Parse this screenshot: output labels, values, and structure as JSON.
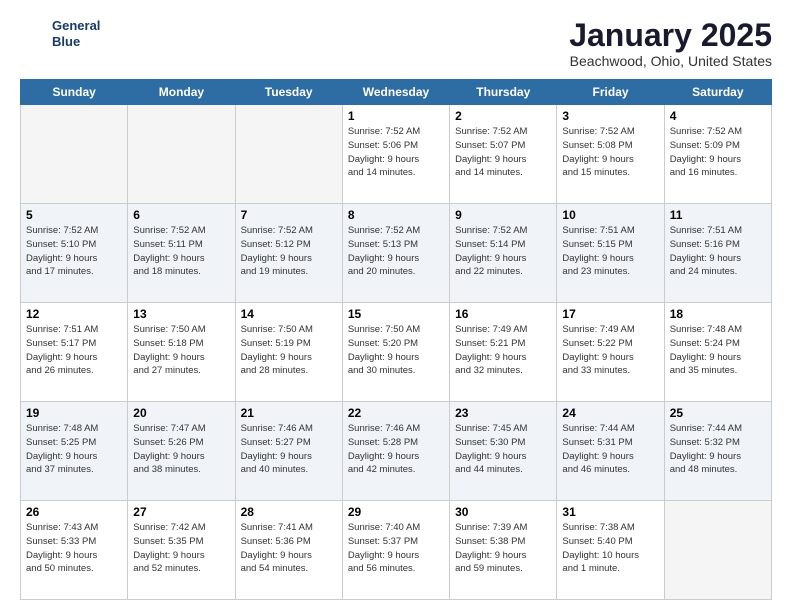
{
  "header": {
    "logo_line1": "General",
    "logo_line2": "Blue",
    "month_title": "January 2025",
    "location": "Beachwood, Ohio, United States"
  },
  "days_of_week": [
    "Sunday",
    "Monday",
    "Tuesday",
    "Wednesday",
    "Thursday",
    "Friday",
    "Saturday"
  ],
  "weeks": [
    {
      "shade": false,
      "days": [
        {
          "num": "",
          "info": ""
        },
        {
          "num": "",
          "info": ""
        },
        {
          "num": "",
          "info": ""
        },
        {
          "num": "1",
          "info": "Sunrise: 7:52 AM\nSunset: 5:06 PM\nDaylight: 9 hours\nand 14 minutes."
        },
        {
          "num": "2",
          "info": "Sunrise: 7:52 AM\nSunset: 5:07 PM\nDaylight: 9 hours\nand 14 minutes."
        },
        {
          "num": "3",
          "info": "Sunrise: 7:52 AM\nSunset: 5:08 PM\nDaylight: 9 hours\nand 15 minutes."
        },
        {
          "num": "4",
          "info": "Sunrise: 7:52 AM\nSunset: 5:09 PM\nDaylight: 9 hours\nand 16 minutes."
        }
      ]
    },
    {
      "shade": true,
      "days": [
        {
          "num": "5",
          "info": "Sunrise: 7:52 AM\nSunset: 5:10 PM\nDaylight: 9 hours\nand 17 minutes."
        },
        {
          "num": "6",
          "info": "Sunrise: 7:52 AM\nSunset: 5:11 PM\nDaylight: 9 hours\nand 18 minutes."
        },
        {
          "num": "7",
          "info": "Sunrise: 7:52 AM\nSunset: 5:12 PM\nDaylight: 9 hours\nand 19 minutes."
        },
        {
          "num": "8",
          "info": "Sunrise: 7:52 AM\nSunset: 5:13 PM\nDaylight: 9 hours\nand 20 minutes."
        },
        {
          "num": "9",
          "info": "Sunrise: 7:52 AM\nSunset: 5:14 PM\nDaylight: 9 hours\nand 22 minutes."
        },
        {
          "num": "10",
          "info": "Sunrise: 7:51 AM\nSunset: 5:15 PM\nDaylight: 9 hours\nand 23 minutes."
        },
        {
          "num": "11",
          "info": "Sunrise: 7:51 AM\nSunset: 5:16 PM\nDaylight: 9 hours\nand 24 minutes."
        }
      ]
    },
    {
      "shade": false,
      "days": [
        {
          "num": "12",
          "info": "Sunrise: 7:51 AM\nSunset: 5:17 PM\nDaylight: 9 hours\nand 26 minutes."
        },
        {
          "num": "13",
          "info": "Sunrise: 7:50 AM\nSunset: 5:18 PM\nDaylight: 9 hours\nand 27 minutes."
        },
        {
          "num": "14",
          "info": "Sunrise: 7:50 AM\nSunset: 5:19 PM\nDaylight: 9 hours\nand 28 minutes."
        },
        {
          "num": "15",
          "info": "Sunrise: 7:50 AM\nSunset: 5:20 PM\nDaylight: 9 hours\nand 30 minutes."
        },
        {
          "num": "16",
          "info": "Sunrise: 7:49 AM\nSunset: 5:21 PM\nDaylight: 9 hours\nand 32 minutes."
        },
        {
          "num": "17",
          "info": "Sunrise: 7:49 AM\nSunset: 5:22 PM\nDaylight: 9 hours\nand 33 minutes."
        },
        {
          "num": "18",
          "info": "Sunrise: 7:48 AM\nSunset: 5:24 PM\nDaylight: 9 hours\nand 35 minutes."
        }
      ]
    },
    {
      "shade": true,
      "days": [
        {
          "num": "19",
          "info": "Sunrise: 7:48 AM\nSunset: 5:25 PM\nDaylight: 9 hours\nand 37 minutes."
        },
        {
          "num": "20",
          "info": "Sunrise: 7:47 AM\nSunset: 5:26 PM\nDaylight: 9 hours\nand 38 minutes."
        },
        {
          "num": "21",
          "info": "Sunrise: 7:46 AM\nSunset: 5:27 PM\nDaylight: 9 hours\nand 40 minutes."
        },
        {
          "num": "22",
          "info": "Sunrise: 7:46 AM\nSunset: 5:28 PM\nDaylight: 9 hours\nand 42 minutes."
        },
        {
          "num": "23",
          "info": "Sunrise: 7:45 AM\nSunset: 5:30 PM\nDaylight: 9 hours\nand 44 minutes."
        },
        {
          "num": "24",
          "info": "Sunrise: 7:44 AM\nSunset: 5:31 PM\nDaylight: 9 hours\nand 46 minutes."
        },
        {
          "num": "25",
          "info": "Sunrise: 7:44 AM\nSunset: 5:32 PM\nDaylight: 9 hours\nand 48 minutes."
        }
      ]
    },
    {
      "shade": false,
      "days": [
        {
          "num": "26",
          "info": "Sunrise: 7:43 AM\nSunset: 5:33 PM\nDaylight: 9 hours\nand 50 minutes."
        },
        {
          "num": "27",
          "info": "Sunrise: 7:42 AM\nSunset: 5:35 PM\nDaylight: 9 hours\nand 52 minutes."
        },
        {
          "num": "28",
          "info": "Sunrise: 7:41 AM\nSunset: 5:36 PM\nDaylight: 9 hours\nand 54 minutes."
        },
        {
          "num": "29",
          "info": "Sunrise: 7:40 AM\nSunset: 5:37 PM\nDaylight: 9 hours\nand 56 minutes."
        },
        {
          "num": "30",
          "info": "Sunrise: 7:39 AM\nSunset: 5:38 PM\nDaylight: 9 hours\nand 59 minutes."
        },
        {
          "num": "31",
          "info": "Sunrise: 7:38 AM\nSunset: 5:40 PM\nDaylight: 10 hours\nand 1 minute."
        },
        {
          "num": "",
          "info": ""
        }
      ]
    }
  ]
}
